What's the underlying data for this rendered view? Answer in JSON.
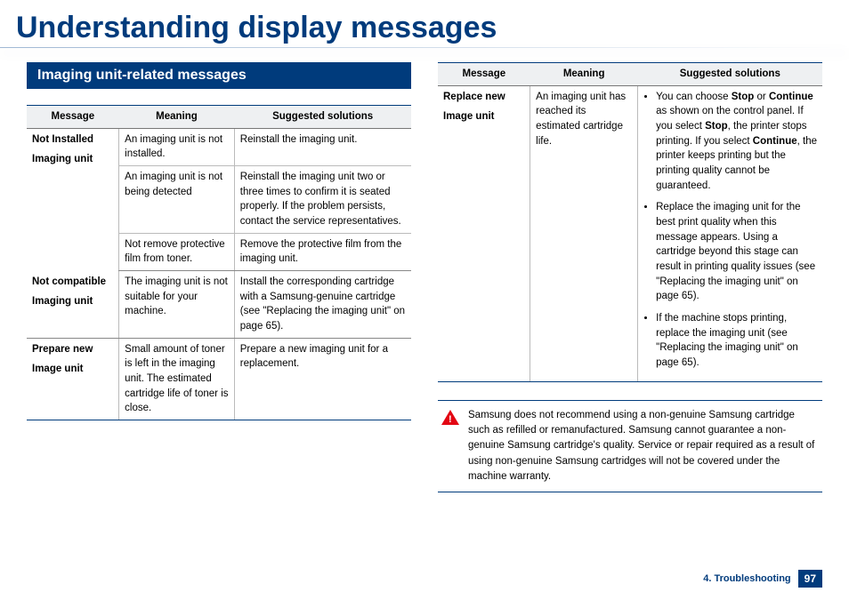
{
  "page_title": "Understanding display messages",
  "section_header": "Imaging unit-related messages",
  "table_headers": {
    "msg": "Message",
    "meaning": "Meaning",
    "sol": "Suggested solutions"
  },
  "left_rows": [
    {
      "msg_line1": "Not Installed",
      "msg_line2": "Imaging unit",
      "meaning": "An imaging unit is not installed.",
      "sol_plain": "Reinstall the imaging unit."
    },
    {
      "msg_line1": "",
      "msg_line2": "",
      "meaning": "An imaging unit is not being detected",
      "sol_plain": "Reinstall the imaging unit two or three times to confirm it is seated properly. If the problem persists, contact the service representatives."
    },
    {
      "msg_line1": "",
      "msg_line2": "",
      "meaning": "Not remove protective film from toner.",
      "sol_plain": "Remove the protective film from the imaging unit."
    },
    {
      "msg_line1": "Not compatible",
      "msg_line2": "Imaging unit",
      "meaning": "The imaging unit is not suitable for your machine.",
      "sol_plain": "Install the corresponding cartridge with a Samsung-genuine cartridge (see \"Replacing the imaging unit\" on page 65)."
    },
    {
      "msg_line1": "Prepare new",
      "msg_line2": "Image unit",
      "meaning": "Small amount of toner is left in the imaging unit. The estimated cartridge life of toner is close.",
      "sol_plain": "Prepare a new imaging unit for a replacement."
    }
  ],
  "right_row": {
    "msg_line1": "Replace new",
    "msg_line2": "Image unit",
    "meaning": "An imaging unit has reached its estimated cartridge life.",
    "sol_bullets": {
      "b0_pre": "You can choose ",
      "b0_stop": "Stop",
      "b0_mid1": " or ",
      "b0_cont": "Continue",
      "b0_mid2": " as shown on the control panel. If you select ",
      "b0_stop2": "Stop",
      "b0_mid3": ", the printer stops printing. If you select ",
      "b0_cont2": "Continue",
      "b0_post": ", the printer keeps printing but the printing quality cannot be guaranteed.",
      "b1": "Replace the imaging unit for the best print quality when this message appears. Using a cartridge beyond this stage can result in printing quality issues (see \"Replacing the imaging unit\" on page 65).",
      "b2": "If the machine stops printing, replace the imaging unit (see \"Replacing the imaging unit\" on page 65)."
    }
  },
  "warning_text": "Samsung does not recommend using a non-genuine Samsung cartridge such as refilled or remanufactured. Samsung cannot guarantee a non-genuine Samsung cartridge's quality. Service or repair required as a result of using non-genuine Samsung cartridges will not be covered under the machine warranty.",
  "footer": {
    "chapter": "4. Troubleshooting",
    "page": "97"
  }
}
